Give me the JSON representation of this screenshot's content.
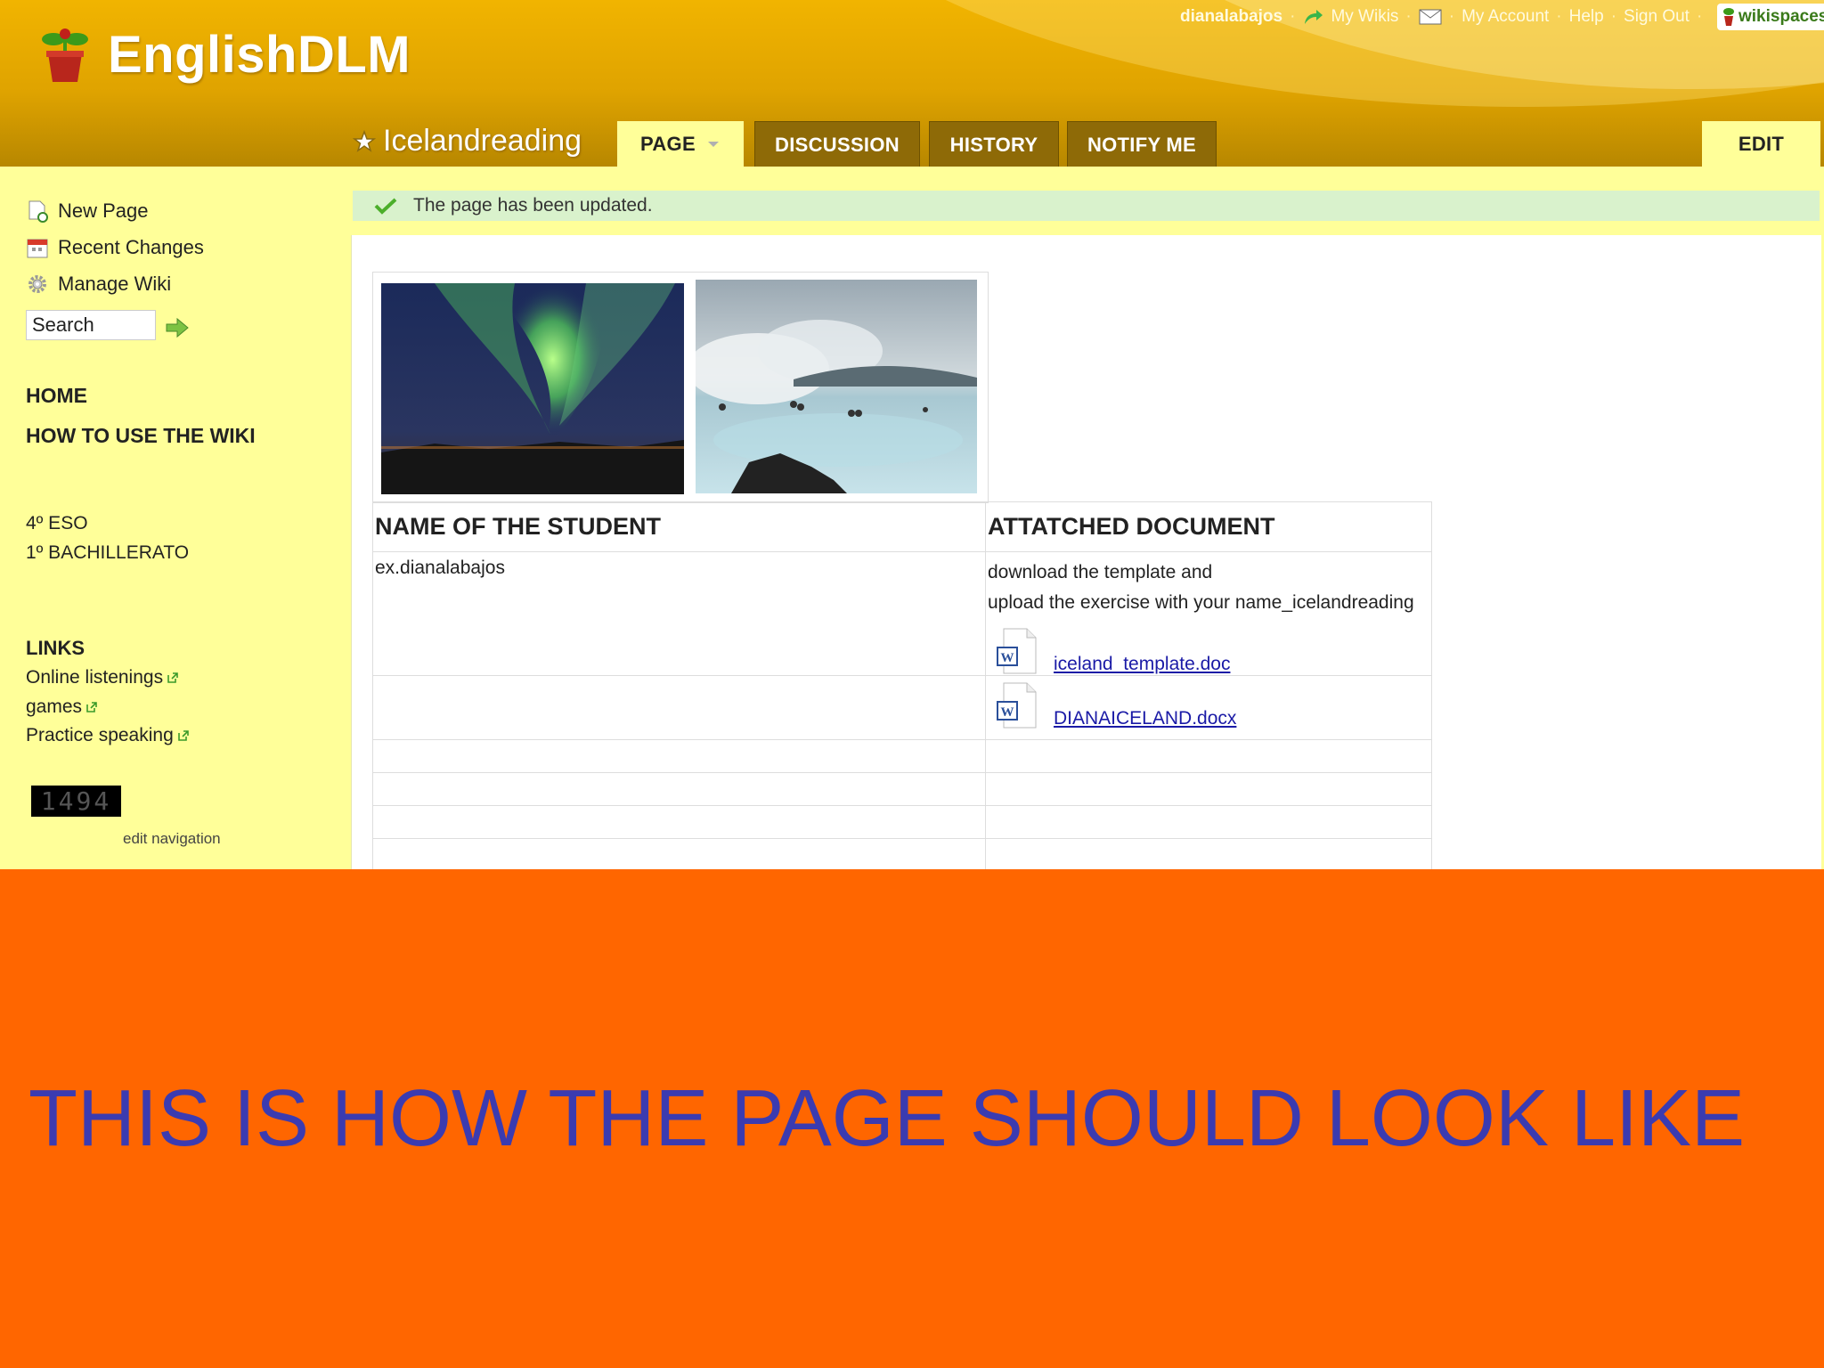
{
  "header": {
    "brand": "EnglishDLM",
    "user": "dianalabajos",
    "my_wikis": "My Wikis",
    "my_account": "My Account",
    "help": "Help",
    "sign_out": "Sign Out",
    "wikispaces": "wikispaces",
    "separator": "·"
  },
  "page": {
    "title": "Icelandreading",
    "tabs": [
      {
        "label": "PAGE"
      },
      {
        "label": "DISCUSSION"
      },
      {
        "label": "HISTORY"
      },
      {
        "label": "NOTIFY ME"
      }
    ],
    "edit": "EDIT",
    "notice": "The page has been updated."
  },
  "sidebar": {
    "actions": [
      {
        "label": "New Page",
        "icon": "new-page-icon"
      },
      {
        "label": "Recent Changes",
        "icon": "calendar-icon"
      },
      {
        "label": "Manage Wiki",
        "icon": "gear-icon"
      }
    ],
    "search_value": "Search",
    "nav": {
      "home": "HOME",
      "how_to": "HOW TO USE THE WIKI",
      "eso": "4º ESO",
      "bach": "1º BACHILLERATO",
      "links_heading": "LINKS",
      "links": [
        "Online listenings",
        "games",
        "Practice speaking"
      ]
    },
    "counter": "1494",
    "edit_navigation": "edit navigation"
  },
  "table": {
    "col1_header": "NAME OF THE STUDENT",
    "col2_header": "ATTATCHED DOCUMENT",
    "row1_name": "ex.dianalabajos",
    "row1_text1": "download the template and",
    "row1_text2": "upload the exercise with your name_icelandreading",
    "doc1": "iceland_template.doc",
    "doc2": "DIANAICELAND.docx"
  },
  "caption": "THIS IS HOW THE PAGE SHOULD LOOK LIKE",
  "colors": {
    "orange_bg": "#ff6600",
    "caption_blue": "#3b3bb0",
    "sidebar_yellow": "#ffff99",
    "header_gold": "#dfa300"
  }
}
